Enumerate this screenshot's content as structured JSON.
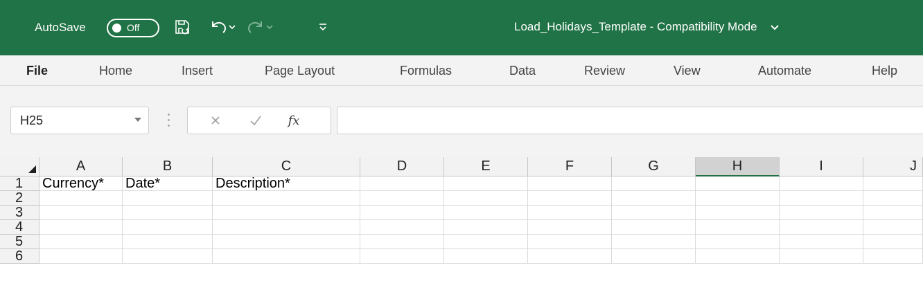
{
  "titlebar": {
    "autosave_label": "AutoSave",
    "autosave_state": "Off",
    "document_title": "Load_Holidays_Template  -  Compatibility Mode",
    "icons": [
      "save-icon",
      "undo-icon",
      "undo-dropdown-icon",
      "redo-icon",
      "redo-dropdown-icon",
      "customize-quick-access-icon",
      "title-dropdown-icon"
    ]
  },
  "ribbon": {
    "tabs": [
      "File",
      "Home",
      "Insert",
      "Page Layout",
      "Formulas",
      "Data",
      "Review",
      "View",
      "Automate",
      "Help"
    ],
    "active_tab": "File"
  },
  "formula_bar": {
    "name_box": "H25",
    "fx_label": "fx",
    "formula": ""
  },
  "grid": {
    "columns": [
      "A",
      "B",
      "C",
      "D",
      "E",
      "F",
      "G",
      "H",
      "I",
      "J"
    ],
    "selected_column": "H",
    "rows": [
      "1",
      "2",
      "3",
      "4",
      "5",
      "6"
    ],
    "cells": {
      "A1": "Currency*",
      "B1": "Date*",
      "C1": "Description*"
    }
  },
  "colors": {
    "title_bar": "#207346",
    "ribbon_bg": "#f3f3f3",
    "selected_header_accent": "#217346"
  }
}
